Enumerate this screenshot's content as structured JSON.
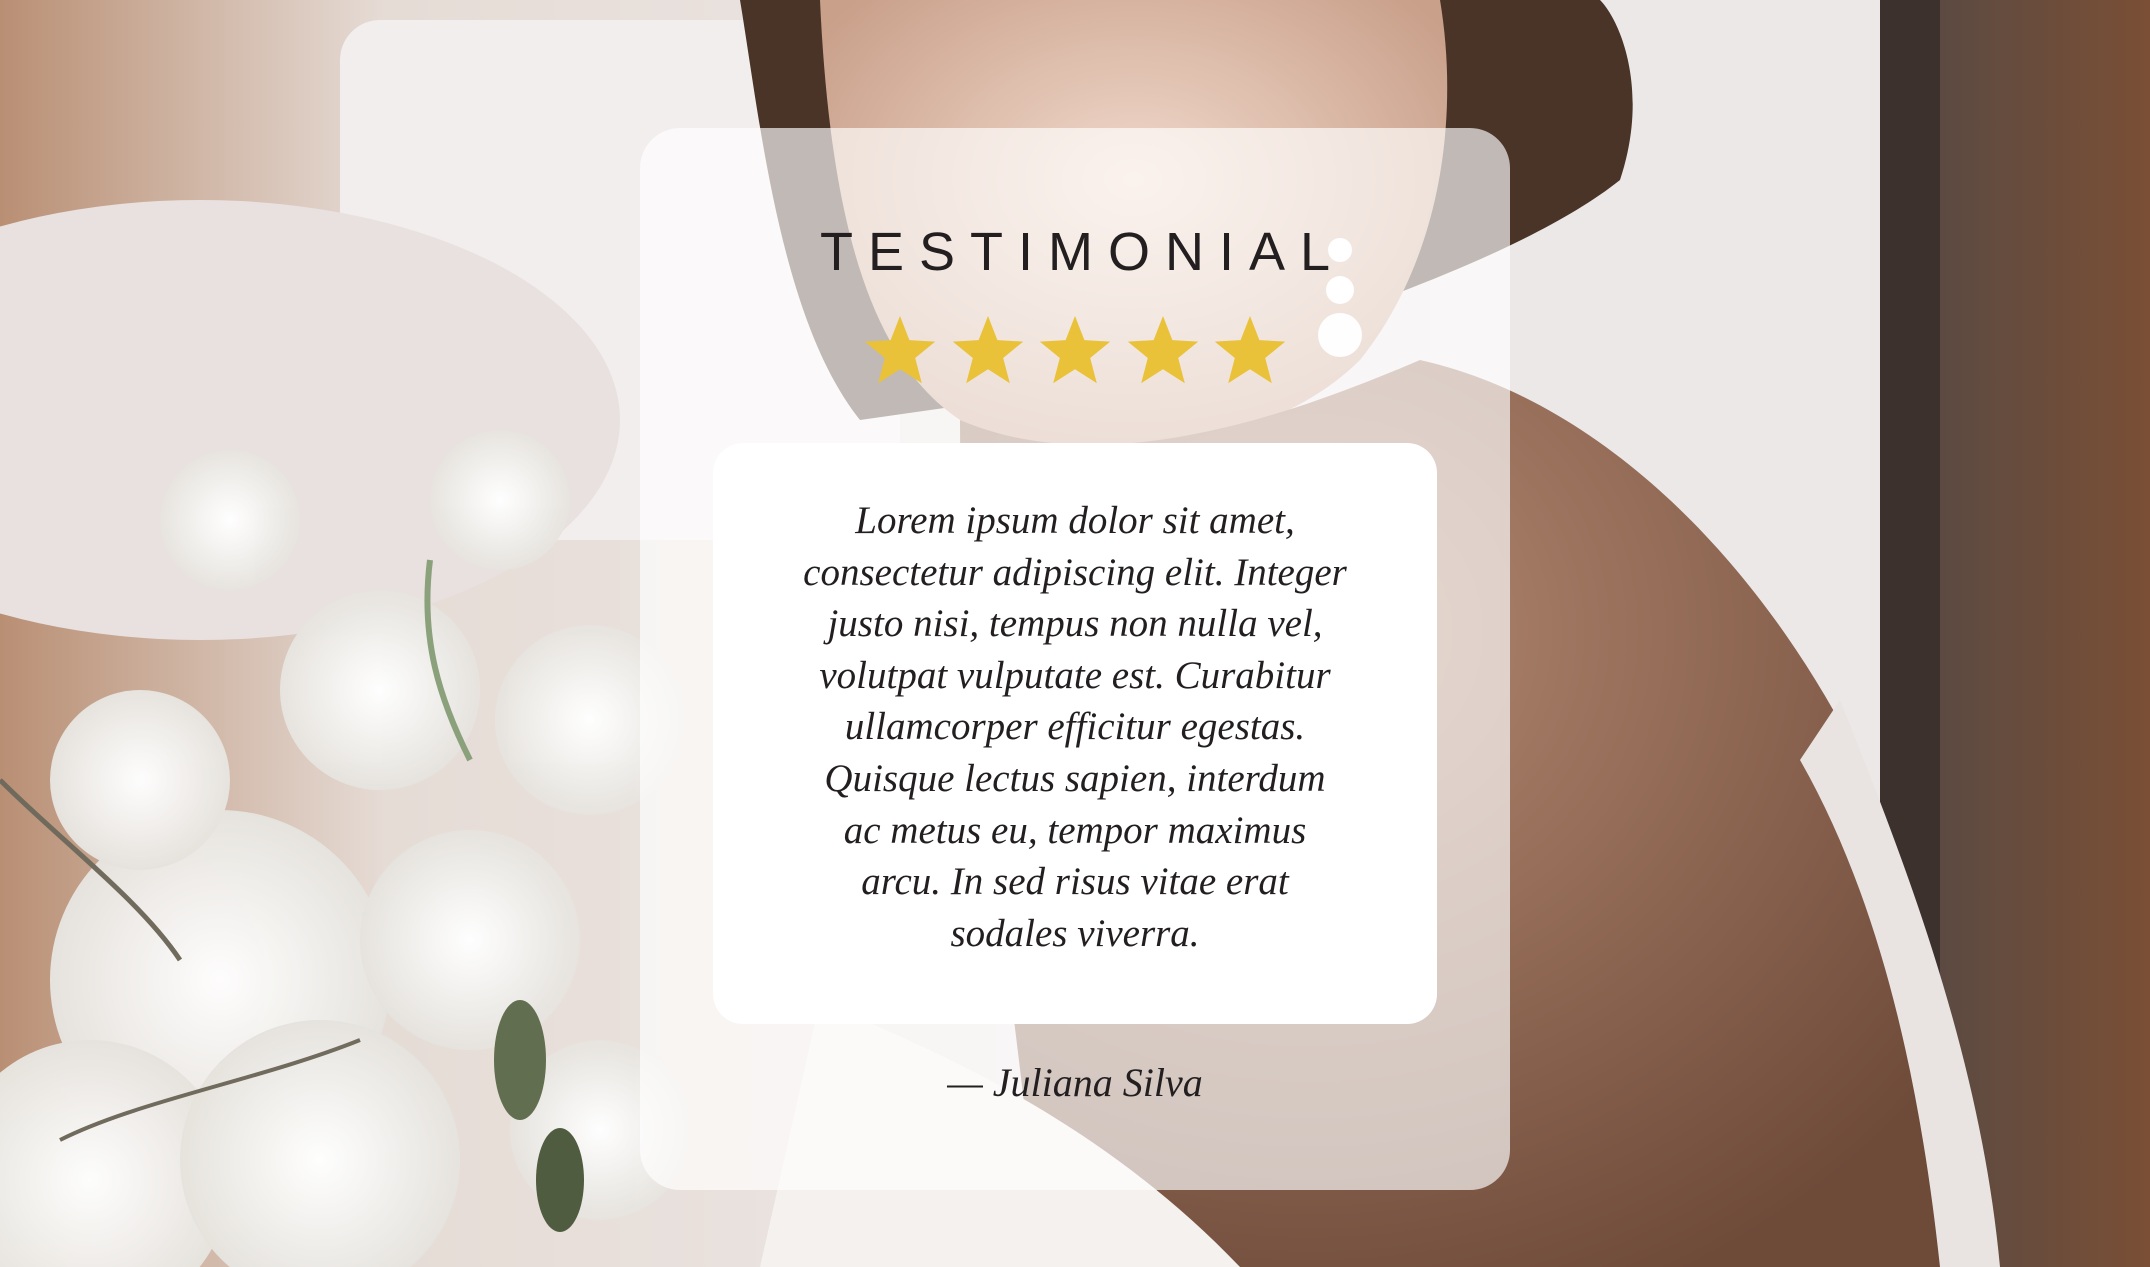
{
  "testimonial": {
    "heading": "TESTIMONIAL",
    "rating": 5,
    "rating_max": 5,
    "quote": "Lorem ipsum dolor sit amet, consectetur adipiscing elit. Integer justo nisi, tempus non nulla vel, volutpat vulputate est. Curabitur ullamcorper efficitur egestas. Quisque lectus sapien, interdum ac metus eu, tempor maximus arcu. In sed risus vitae erat sodales viverra.",
    "author": "— Juliana Silva"
  },
  "colors": {
    "star": "#e9c23a",
    "text": "#231f20",
    "card_overlay": "rgba(255,255,255,0.66)",
    "quote_box": "#ffffff"
  },
  "icons": {
    "star": "star-icon"
  }
}
